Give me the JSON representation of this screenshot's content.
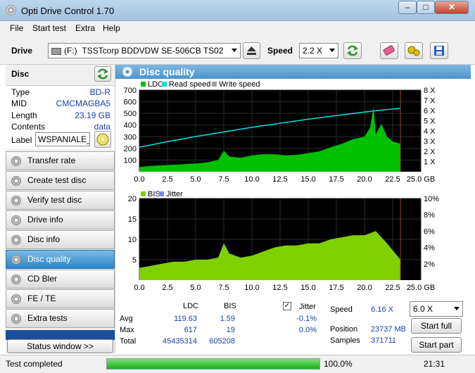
{
  "window": {
    "title": "Opti Drive Control 1.70",
    "min": "–",
    "max": "□",
    "close": "✕"
  },
  "menu": [
    "File",
    "Start test",
    "Extra",
    "Help"
  ],
  "toolbar": {
    "drive_label": "Drive",
    "drive_letter": "(F:)",
    "drive_value": "TSSTcorp BDDVDW SE-506CB TS02",
    "speed_label": "Speed",
    "speed_value": "2.2 X"
  },
  "disc": {
    "header": "Disc",
    "rows": [
      {
        "label": "Type",
        "value": "BD-R"
      },
      {
        "label": "MID",
        "value": "CMCMAGBA5"
      },
      {
        "label": "Length",
        "value": "23.19 GB"
      },
      {
        "label": "Contents",
        "value": "data"
      }
    ],
    "label_label": "Label",
    "label_value": "WSPANIALE_S"
  },
  "nav": [
    "Transfer rate",
    "Create test disc",
    "Verify test disc",
    "Drive info",
    "Disc info",
    "Disc quality",
    "CD Bler",
    "FE / TE",
    "Extra tests"
  ],
  "nav_active": "Disc quality",
  "status_window_btn": "Status window >>",
  "panel_title": "Disc quality",
  "chart_data": [
    {
      "type": "area",
      "legend": [
        "LDC",
        "Read speed",
        "Write speed"
      ],
      "colors": {
        "ldc": "#00c000",
        "read": "#00e0e0",
        "write": "#a0a0a0"
      },
      "x_ticks": [
        "0.0",
        "2.5",
        "5.0",
        "7.5",
        "10.0",
        "12.5",
        "15.0",
        "17.5",
        "20.0",
        "22.5",
        "25.0 GB"
      ],
      "xlim": [
        0,
        25
      ],
      "y_ticks": [
        "700",
        "600",
        "500",
        "400",
        "300",
        "200",
        "100"
      ],
      "ylim": [
        0,
        700
      ],
      "y2_ticks": [
        "8 X",
        "7 X",
        "6 X",
        "5 X",
        "4 X",
        "3 X",
        "2 X",
        "1 X"
      ],
      "y2lim": [
        0,
        8
      ],
      "ldc_x": [
        0,
        1,
        2,
        3,
        4,
        5,
        6,
        7,
        7.5,
        8,
        9,
        10,
        11,
        12,
        13,
        14,
        15,
        16,
        17,
        18,
        19,
        20,
        20.5,
        20.8,
        21,
        21.5,
        22,
        22.5,
        23.19
      ],
      "ldc_y": [
        40,
        50,
        55,
        60,
        65,
        70,
        80,
        100,
        180,
        130,
        120,
        140,
        150,
        150,
        140,
        145,
        160,
        175,
        210,
        240,
        280,
        300,
        380,
        560,
        320,
        410,
        300,
        260,
        240
      ],
      "speed_x": [
        0,
        2.5,
        5,
        7.5,
        10,
        12.5,
        15,
        17.5,
        20,
        22.5,
        23.19
      ],
      "speed_y": [
        2.4,
        2.95,
        3.45,
        3.9,
        4.35,
        4.75,
        5.15,
        5.5,
        5.85,
        6.15,
        6.2
      ]
    },
    {
      "type": "area",
      "legend": [
        "BIS",
        "Jitter"
      ],
      "colors": {
        "bis": "#80d000",
        "jitter": "#8080ff"
      },
      "x_ticks": [
        "0.0",
        "2.5",
        "5.0",
        "7.5",
        "10.0",
        "12.5",
        "15.0",
        "17.5",
        "20.0",
        "22.5",
        "25.0 GB"
      ],
      "xlim": [
        0,
        25
      ],
      "y_ticks": [
        "20",
        "15",
        "10",
        "5"
      ],
      "ylim": [
        0,
        20
      ],
      "y2_ticks": [
        "10%",
        "8%",
        "6%",
        "4%",
        "2%"
      ],
      "y2lim": [
        0,
        10
      ],
      "bis_x": [
        0,
        1,
        2,
        3,
        4,
        5,
        6,
        7,
        7.5,
        8,
        9,
        10,
        11,
        12,
        13,
        14,
        15,
        16,
        17,
        18,
        19,
        20,
        21,
        22,
        23.19
      ],
      "bis_y": [
        3,
        3.5,
        4,
        4.5,
        4.5,
        5,
        5,
        5.5,
        9,
        6.5,
        5.5,
        6,
        7,
        8,
        8.5,
        8.5,
        9,
        9,
        10,
        10.5,
        11,
        11,
        12,
        9,
        5
      ]
    }
  ],
  "stats": {
    "col_ldc": "LDC",
    "col_bis": "BIS",
    "jitter_label": "Jitter",
    "jitter_checked": "✓",
    "rows": [
      {
        "label": "Avg",
        "ldc": "119.63",
        "bis": "1.59",
        "jitter": "-0.1%"
      },
      {
        "label": "Max",
        "ldc": "617",
        "bis": "19",
        "jitter": "0.0%"
      },
      {
        "label": "Total",
        "ldc": "45435314",
        "bis": "605208",
        "jitter": ""
      }
    ],
    "speed_label": "Speed",
    "speed_value": "6.16 X",
    "speed_select": "6.0 X",
    "position_label": "Position",
    "position_value": "23737 MB",
    "samples_label": "Samples",
    "samples_value": "371711",
    "start_full": "Start full",
    "start_part": "Start part"
  },
  "status": {
    "text": "Test completed",
    "progress": 100,
    "progress_text": "100.0%",
    "time": "21:31"
  }
}
